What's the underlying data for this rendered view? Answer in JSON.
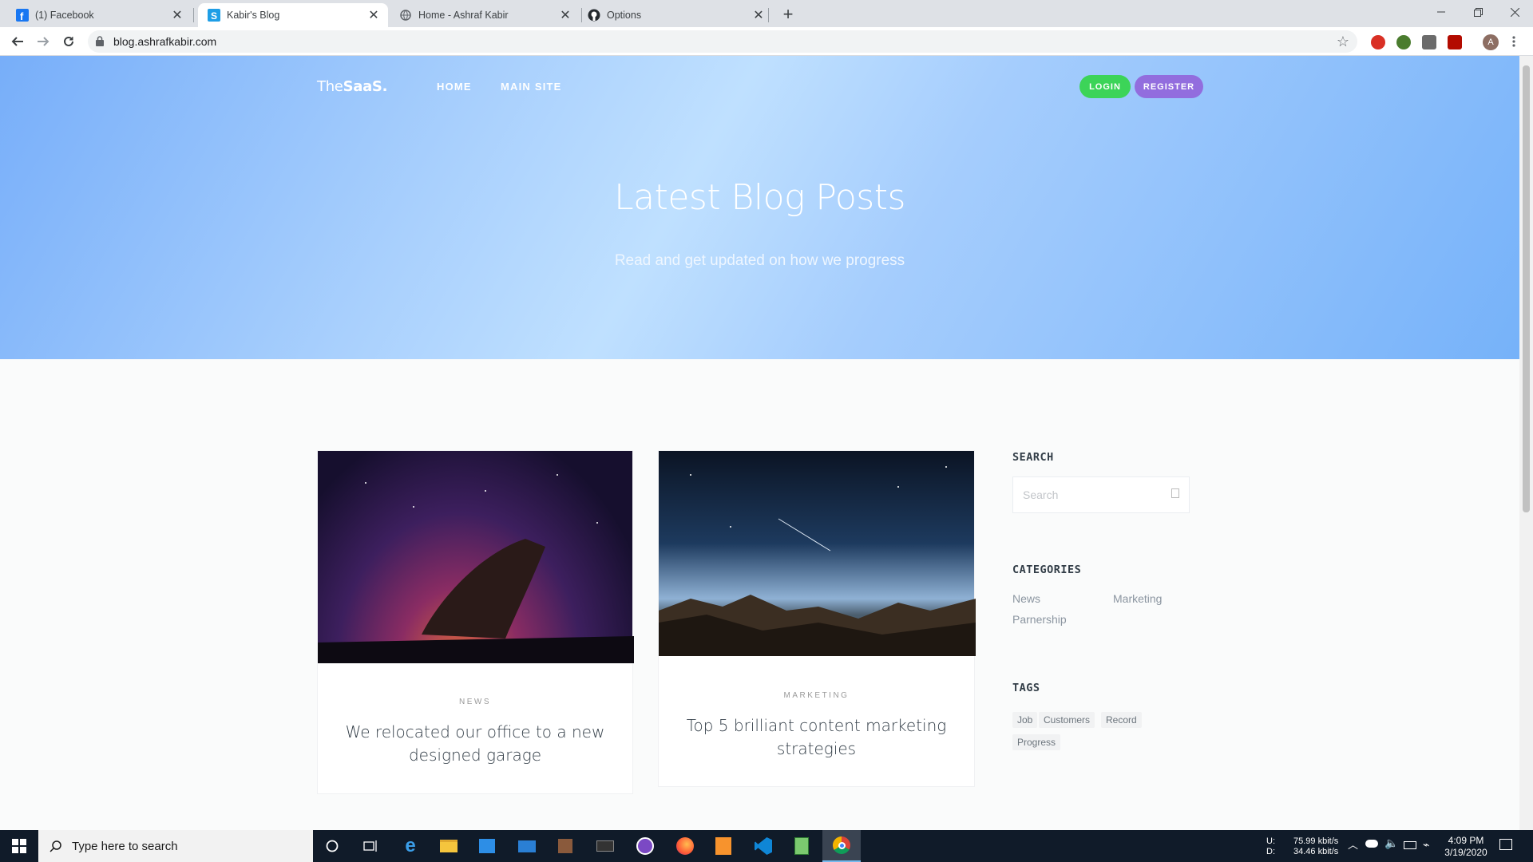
{
  "browser": {
    "tabs": [
      {
        "title": "(1) Facebook",
        "icon": "facebook-icon"
      },
      {
        "title": "Kabir's Blog",
        "icon": "blog-s-icon"
      },
      {
        "title": "Home - Ashraf Kabir",
        "icon": "globe-icon"
      },
      {
        "title": "Options",
        "icon": "github-icon"
      }
    ],
    "active_tab": 1,
    "url": "blog.ashrafkabir.com"
  },
  "site": {
    "brand_light": "The",
    "brand_bold": "SaaS",
    "brand_dot": ".",
    "nav": [
      "HOME",
      "MAIN SITE"
    ],
    "login_label": "LOGIN",
    "register_label": "REGISTER",
    "hero_title": "Latest Blog Posts",
    "hero_subtitle": "Read and get updated on how we progress",
    "colors": {
      "login": "#3cd458",
      "register": "#926dde",
      "hero": "#a9d0fd"
    }
  },
  "posts": [
    {
      "category": "NEWS",
      "title": "We relocated our office to a new designed garage",
      "image": "boat-under-milky-way-image"
    },
    {
      "category": "MARKETING",
      "title": "Top 5 brilliant content marketing strategies",
      "image": "mountains-under-starry-sky-image"
    }
  ],
  "sidebar": {
    "search_heading": "SEARCH",
    "search_placeholder": "Search",
    "categories_heading": "CATEGORIES",
    "categories": [
      "News",
      "Marketing",
      "Parnership"
    ],
    "tags_heading": "TAGS",
    "tags": [
      "Job",
      "Customers",
      "Record",
      "Progress"
    ]
  },
  "taskbar": {
    "search_placeholder": "Type here to search",
    "net_up_label": "U:",
    "net_down_label": "D:",
    "net_up": "75.99 kbit/s",
    "net_down": "34.46 kbit/s",
    "time": "4:09 PM",
    "date": "3/19/2020"
  },
  "profile_initial": "A"
}
